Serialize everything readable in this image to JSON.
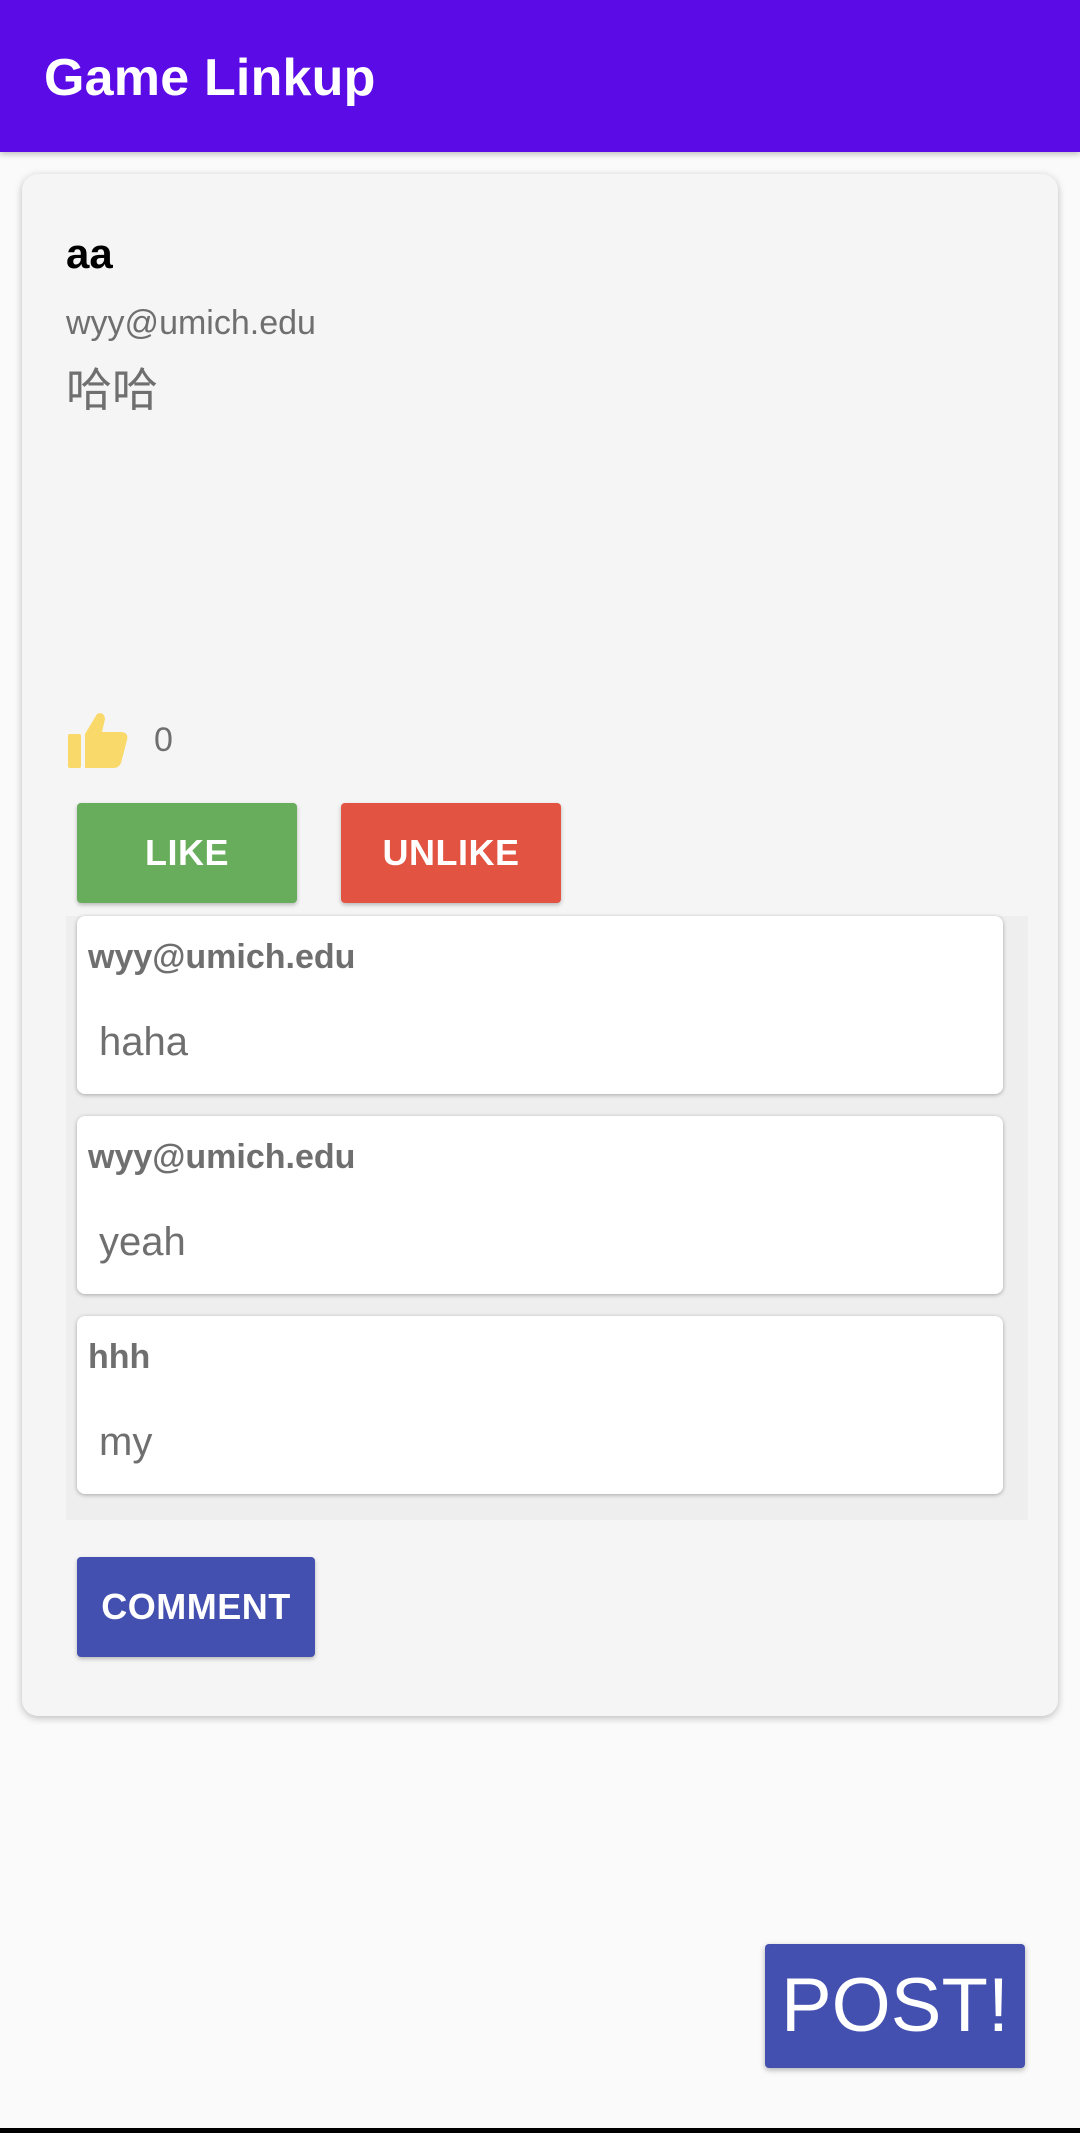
{
  "app_bar": {
    "title": "Game Linkup",
    "background_color": "#5b0be5"
  },
  "post": {
    "title": "aa",
    "author": "wyy@umich.edu",
    "body": "哈哈",
    "like_icon": "thumbs-up-icon",
    "like_count": "0",
    "like_button_label": "LIKE",
    "unlike_button_label": "UNLIKE",
    "comment_button_label": "COMMENT",
    "comments": [
      {
        "author": "wyy@umich.edu",
        "text": "haha"
      },
      {
        "author": "wyy@umich.edu",
        "text": "yeah"
      },
      {
        "author": "hhh",
        "text": "my"
      }
    ]
  },
  "fab": {
    "post_label": "POST!"
  },
  "colors": {
    "like_button": "#67ad5b",
    "unlike_button": "#e25341",
    "comment_button": "#4350b0",
    "post_button": "#4350b0",
    "thumb_icon": "#f9d96a"
  }
}
